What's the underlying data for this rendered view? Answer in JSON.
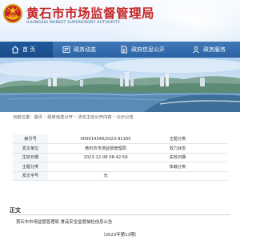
{
  "header": {
    "title": "黄石市市场监督管理局",
    "subtitle": "HUANGSHI MARKET SUPERVISORY AUTHORITY",
    "colors": {
      "title": "#c62424",
      "subtitle": "#2a4f80"
    }
  },
  "nav": {
    "items": [
      {
        "label": "首 页",
        "icon": "home-icon"
      },
      {
        "label": "政务动态",
        "icon": "news-icon"
      },
      {
        "label": "政府信息公开",
        "icon": "document-icon"
      },
      {
        "label": "政务服务",
        "icon": "service-icon"
      }
    ],
    "colors": {
      "bar": "#2c62a3",
      "active": "#184b87"
    }
  },
  "breadcrumb": {
    "prefix": "当前位置：",
    "items": [
      "首页",
      "政府信息公开",
      "法定主动公开内容",
      "公示公告"
    ]
  },
  "meta": {
    "index_label": "索引号",
    "index_value": "000014349/2023-91185",
    "category_label": "主题分类",
    "agency_label": "发文单位",
    "agency_value": "黄石市市场监督管理局",
    "validity_label": "效力状态",
    "date_label": "生效日期",
    "date_value": "2023-12-08 08:42:59",
    "expiry_label": "失效日期",
    "topic_label": "主题分类",
    "genre_label": "体裁分类",
    "docno_label": "发文字号",
    "docno_value": "无"
  },
  "content": {
    "heading": "正文",
    "line1": "黄石市市场监督管理局 食品安全监督抽检信息公告",
    "line2": "（2023年第13期）"
  }
}
